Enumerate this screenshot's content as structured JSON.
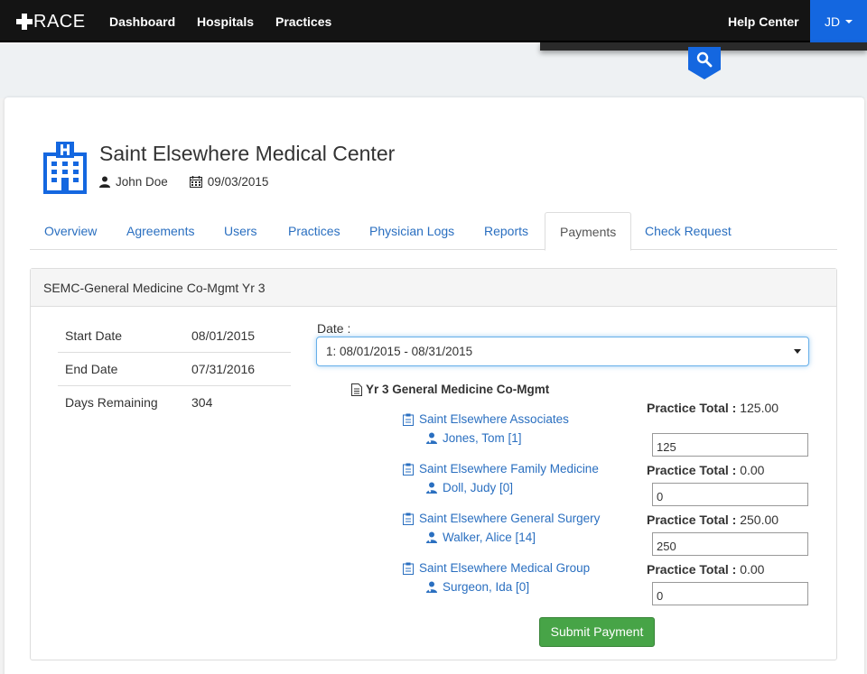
{
  "nav": {
    "brand": "RACE",
    "links": [
      "Dashboard",
      "Hospitals",
      "Practices"
    ],
    "help": "Help Center",
    "user": "JD"
  },
  "hospital": {
    "name": "Saint Elsewhere Medical Center",
    "owner": "John Doe",
    "date": "09/03/2015"
  },
  "tabs": [
    "Overview",
    "Agreements",
    "Users",
    "Practices",
    "Physician Logs",
    "Reports",
    "Payments",
    "Check Request"
  ],
  "active_tab": "Payments",
  "panel": {
    "title": "SEMC-General Medicine Co-Mgmt Yr 3",
    "info": [
      {
        "label": "Start Date",
        "value": "08/01/2015"
      },
      {
        "label": "End Date",
        "value": "07/31/2016"
      },
      {
        "label": "Days Remaining",
        "value": "304"
      }
    ],
    "date_label": "Date :",
    "date_selected": "1: 08/01/2015 - 08/31/2015",
    "agreement_name": "Yr 3 General Medicine Co-Mgmt",
    "practice_total_label": "Practice Total :",
    "practices": [
      {
        "name": "Saint Elsewhere Associates",
        "physician": "Jones, Tom [1]",
        "total": "125.00",
        "input": "125"
      },
      {
        "name": "Saint Elsewhere Family Medicine",
        "physician": "Doll, Judy [0]",
        "total": "0.00",
        "input": "0"
      },
      {
        "name": "Saint Elsewhere General Surgery",
        "physician": "Walker, Alice [14]",
        "total": "250.00",
        "input": "250"
      },
      {
        "name": "Saint Elsewhere Medical Group",
        "physician": "Surgeon, Ida [0]",
        "total": "0.00",
        "input": "0"
      }
    ],
    "submit_label": "Submit Payment"
  },
  "colors": {
    "nav_bg": "#141414",
    "accent_blue": "#1467e0",
    "link": "#2a6fc0",
    "success": "#47a447"
  }
}
